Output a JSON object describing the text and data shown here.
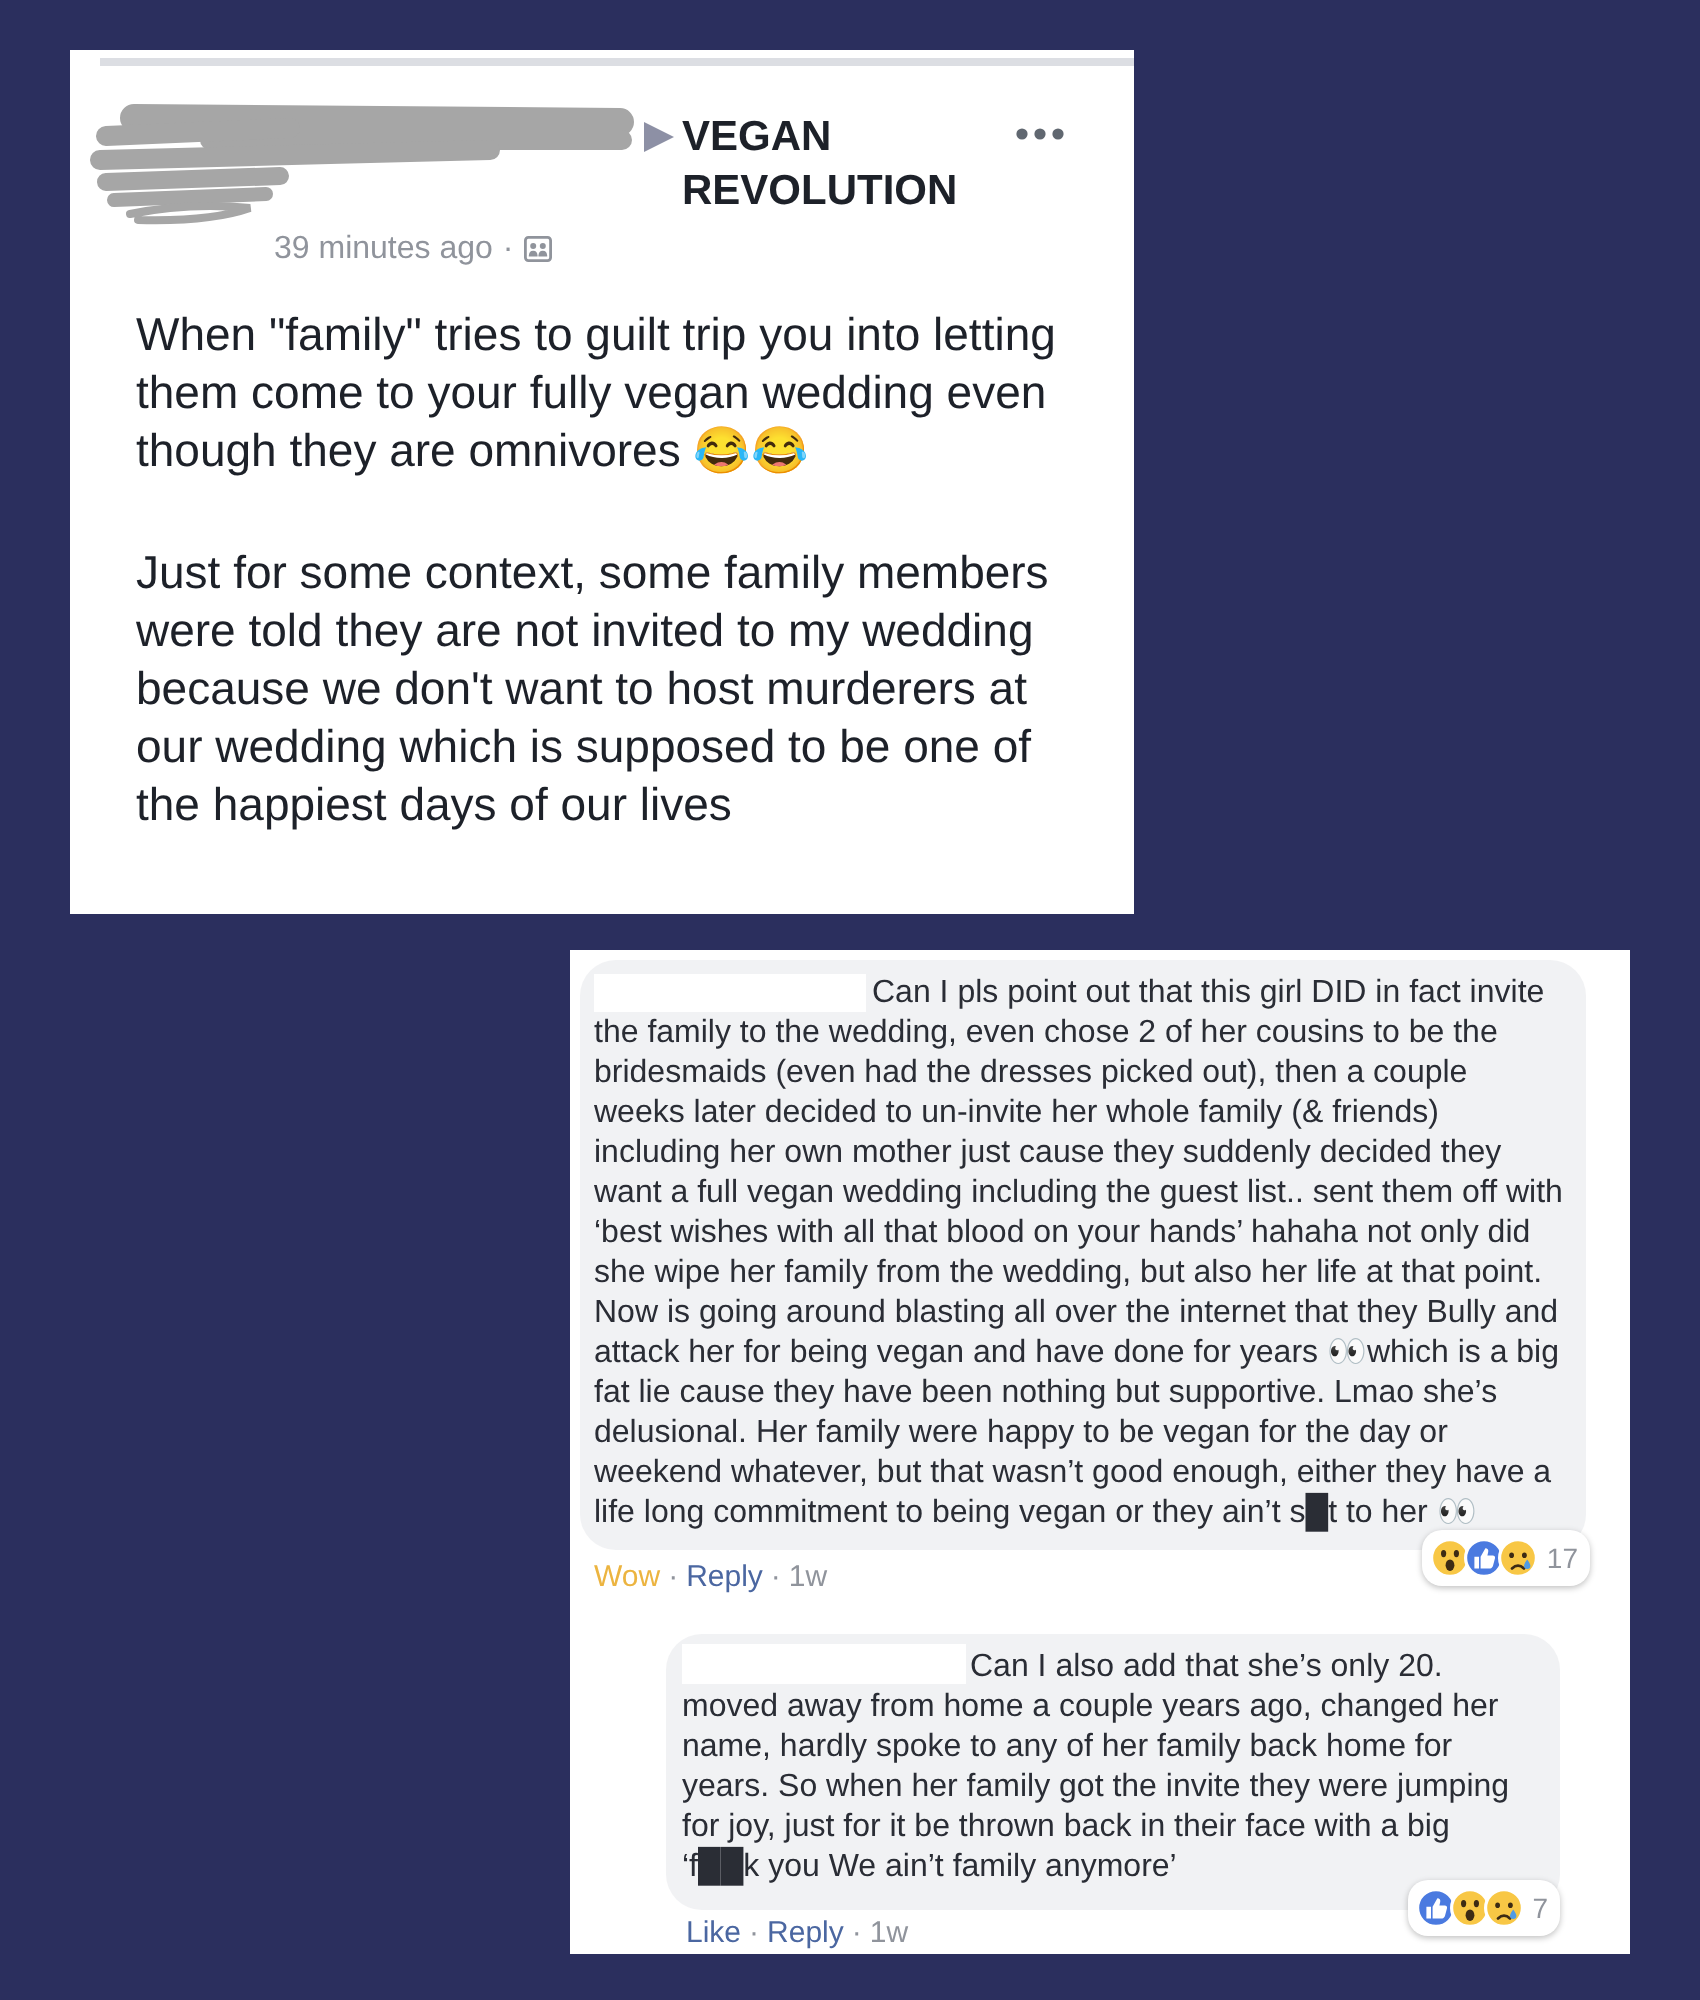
{
  "post": {
    "group_name": "VEGAN REVOLUTION",
    "timestamp": "39 minutes ago",
    "separator": "·",
    "paragraphs": [
      "When \"family\" tries to guilt trip you into letting them come to your fully vegan wedding even though they are omnivores 😂😂",
      "Just for some context, some family members were told they are not invited to my wedding because we don't want to host murderers at our wedding which is supposed to be one of the happiest days of our lives"
    ]
  },
  "comment": {
    "text": "Can I pls point out that this girl DID in fact invite the family to the wedding, even chose 2 of her cousins to be the bridesmaids (even had the dresses picked out), then a couple weeks later decided to un-invite her whole family (& friends) including her own mother just cause they suddenly decided they want a full vegan wedding including the guest list.. sent them off with ‘best wishes with all that blood on your hands’ hahaha not only did she wipe her family from the wedding, but also her life at that point. Now is going around blasting all over the internet that they Bully and attack her for being vegan and have done for years 👀which is a big fat lie cause they have been nothing but supportive. Lmao she’s delusional. Her family were happy to be vegan for the day or weekend whatever, but that wasn’t good enough, either they have a life long commitment to being vegan or they ain’t s█t to her 👀",
    "reactions": [
      {
        "kind": "wow"
      },
      {
        "kind": "like"
      },
      {
        "kind": "sad"
      }
    ],
    "reaction_count": "17",
    "reaction_link": {
      "label": "Wow",
      "reacted": true
    },
    "separators": [
      "·",
      "·"
    ],
    "reply_link": "Reply",
    "time": "1w"
  },
  "reply": {
    "text": "Can I also add that she’s only 20.\nmoved away from home a couple years ago, changed her name, hardly spoke to any of her family back home for years. So when her family got the invite they were jumping for joy, just for it be thrown back in their face with a big ‘f██k you We ain’t family anymore’",
    "reactions": [
      {
        "kind": "like"
      },
      {
        "kind": "wow"
      },
      {
        "kind": "sad"
      }
    ],
    "reaction_count": "7",
    "reaction_link": {
      "label": "Like",
      "reacted": false
    },
    "separators": [
      "·",
      "·"
    ],
    "reply_link": "Reply",
    "time": "1w"
  }
}
